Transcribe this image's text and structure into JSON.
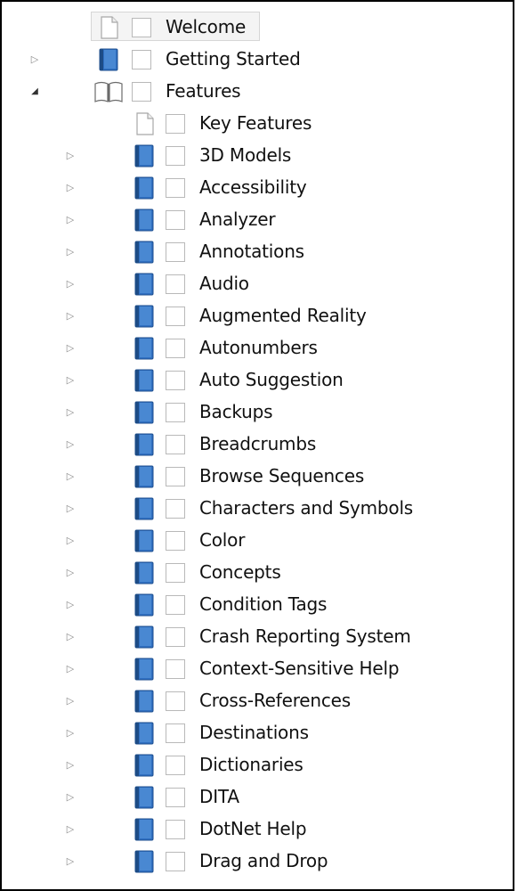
{
  "tree": {
    "items": [
      {
        "label": "Welcome",
        "type": "page",
        "level": 0,
        "expander": "none",
        "selected": true
      },
      {
        "label": "Getting Started",
        "type": "book",
        "level": 0,
        "expander": "collapsed"
      },
      {
        "label": "Features",
        "type": "book-open",
        "level": 0,
        "expander": "expanded"
      },
      {
        "label": "Key Features",
        "type": "page",
        "level": 1,
        "expander": "none"
      },
      {
        "label": "3D Models",
        "type": "book",
        "level": 1,
        "expander": "collapsed"
      },
      {
        "label": "Accessibility",
        "type": "book",
        "level": 1,
        "expander": "collapsed"
      },
      {
        "label": "Analyzer",
        "type": "book",
        "level": 1,
        "expander": "collapsed"
      },
      {
        "label": "Annotations",
        "type": "book",
        "level": 1,
        "expander": "collapsed"
      },
      {
        "label": "Audio",
        "type": "book",
        "level": 1,
        "expander": "collapsed"
      },
      {
        "label": "Augmented Reality",
        "type": "book",
        "level": 1,
        "expander": "collapsed"
      },
      {
        "label": "Autonumbers",
        "type": "book",
        "level": 1,
        "expander": "collapsed"
      },
      {
        "label": "Auto Suggestion",
        "type": "book",
        "level": 1,
        "expander": "collapsed"
      },
      {
        "label": "Backups",
        "type": "book",
        "level": 1,
        "expander": "collapsed"
      },
      {
        "label": "Breadcrumbs",
        "type": "book",
        "level": 1,
        "expander": "collapsed"
      },
      {
        "label": "Browse Sequences",
        "type": "book",
        "level": 1,
        "expander": "collapsed"
      },
      {
        "label": "Characters and Symbols",
        "type": "book",
        "level": 1,
        "expander": "collapsed"
      },
      {
        "label": "Color",
        "type": "book",
        "level": 1,
        "expander": "collapsed"
      },
      {
        "label": "Concepts",
        "type": "book",
        "level": 1,
        "expander": "collapsed"
      },
      {
        "label": "Condition Tags",
        "type": "book",
        "level": 1,
        "expander": "collapsed"
      },
      {
        "label": "Crash Reporting System",
        "type": "book",
        "level": 1,
        "expander": "collapsed"
      },
      {
        "label": "Context-Sensitive Help",
        "type": "book",
        "level": 1,
        "expander": "collapsed"
      },
      {
        "label": "Cross-References",
        "type": "book",
        "level": 1,
        "expander": "collapsed"
      },
      {
        "label": "Destinations",
        "type": "book",
        "level": 1,
        "expander": "collapsed"
      },
      {
        "label": "Dictionaries",
        "type": "book",
        "level": 1,
        "expander": "collapsed"
      },
      {
        "label": "DITA",
        "type": "book",
        "level": 1,
        "expander": "collapsed"
      },
      {
        "label": "DotNet Help",
        "type": "book",
        "level": 1,
        "expander": "collapsed"
      },
      {
        "label": "Drag and Drop",
        "type": "book",
        "level": 1,
        "expander": "collapsed"
      }
    ]
  },
  "colors": {
    "book_blue": "#2f6fc1",
    "book_blue_light": "#6aa6e6",
    "page_gray": "#a8a8a8"
  }
}
